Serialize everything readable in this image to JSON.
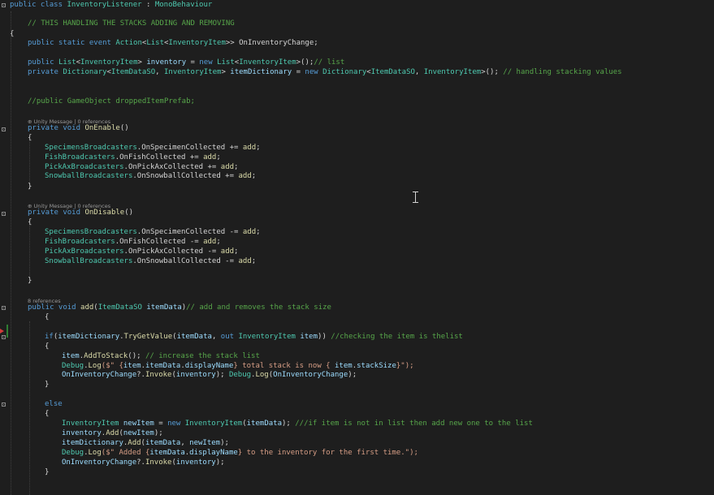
{
  "editor": {
    "lines": [
      [
        [
          "public class ",
          "kw"
        ],
        [
          "InventoryListener",
          "ty"
        ],
        [
          " : ",
          "pl"
        ],
        [
          "MonoBehaviour",
          "ty"
        ]
      ],
      [
        [
          "// THIS HANDLING THE STACKS ADDING AND REMOVING",
          "cm"
        ]
      ],
      [
        [
          "{",
          "pl"
        ]
      ],
      [
        [
          "public static event ",
          "kw"
        ],
        [
          "Action",
          "ty"
        ],
        [
          "<",
          "pl"
        ],
        [
          "List",
          "ty"
        ],
        [
          "<",
          "pl"
        ],
        [
          "InventoryItem",
          "ty"
        ],
        [
          ">> ",
          "pl"
        ],
        [
          "OnInventoryChange",
          "pl"
        ],
        [
          ";",
          "pl"
        ]
      ],
      [
        [
          "public ",
          "kw"
        ],
        [
          "List",
          "ty"
        ],
        [
          "<",
          "pl"
        ],
        [
          "InventoryItem",
          "ty"
        ],
        [
          "> ",
          "pl"
        ],
        [
          "inventory",
          "pr"
        ],
        [
          " = ",
          "pl"
        ],
        [
          "new ",
          "kw"
        ],
        [
          "List",
          "ty"
        ],
        [
          "<",
          "pl"
        ],
        [
          "InventoryItem",
          "ty"
        ],
        [
          ">();",
          "pl"
        ],
        [
          "// list",
          "cm"
        ]
      ],
      [
        [
          "private ",
          "kw"
        ],
        [
          "Dictionary",
          "ty"
        ],
        [
          "<",
          "pl"
        ],
        [
          "ItemDataSO",
          "ty"
        ],
        [
          ", ",
          "pl"
        ],
        [
          "InventoryItem",
          "ty"
        ],
        [
          "> ",
          "pl"
        ],
        [
          "itemDictionary",
          "pr"
        ],
        [
          " = ",
          "pl"
        ],
        [
          "new ",
          "kw"
        ],
        [
          "Dictionary",
          "ty"
        ],
        [
          "<",
          "pl"
        ],
        [
          "ItemDataSO",
          "ty"
        ],
        [
          ", ",
          "pl"
        ],
        [
          "InventoryItem",
          "ty"
        ],
        [
          ">(); ",
          "pl"
        ],
        [
          "// handling stacking values",
          "cm"
        ]
      ],
      [
        [
          "//public GameObject droppedItemPrefab;",
          "cm"
        ]
      ],
      [
        [
          "private void ",
          "kw"
        ],
        [
          "OnEnable",
          "fn"
        ],
        [
          "()",
          "pl"
        ]
      ],
      [
        [
          "{",
          "pl"
        ]
      ],
      [
        [
          "SpecimensBroadcasters",
          "ty"
        ],
        [
          ".",
          "pl"
        ],
        [
          "OnSpecimenCollected",
          "pl"
        ],
        [
          " += ",
          "pl"
        ],
        [
          "add",
          "fn"
        ],
        [
          ";",
          "pl"
        ]
      ],
      [
        [
          "FishBroadcasters",
          "ty"
        ],
        [
          ".",
          "pl"
        ],
        [
          "OnFishCollected",
          "pl"
        ],
        [
          " += ",
          "pl"
        ],
        [
          "add",
          "fn"
        ],
        [
          ";",
          "pl"
        ]
      ],
      [
        [
          "PickAxBroadcasters",
          "ty"
        ],
        [
          ".",
          "pl"
        ],
        [
          "OnPickAxCollected",
          "pl"
        ],
        [
          " += ",
          "pl"
        ],
        [
          "add",
          "fn"
        ],
        [
          ";",
          "pl"
        ]
      ],
      [
        [
          "SnowballBroadcasters",
          "ty"
        ],
        [
          ".",
          "pl"
        ],
        [
          "OnSnowballCollected",
          "pl"
        ],
        [
          " += ",
          "pl"
        ],
        [
          "add",
          "fn"
        ],
        [
          ";",
          "pl"
        ]
      ],
      [
        [
          "}",
          "pl"
        ]
      ],
      [
        [
          "private void ",
          "kw"
        ],
        [
          "OnDisable",
          "fn"
        ],
        [
          "()",
          "pl"
        ]
      ],
      [
        [
          "{",
          "pl"
        ]
      ],
      [
        [
          "SpecimensBroadcasters",
          "ty"
        ],
        [
          ".",
          "pl"
        ],
        [
          "OnSpecimenCollected",
          "pl"
        ],
        [
          " -= ",
          "pl"
        ],
        [
          "add",
          "fn"
        ],
        [
          ";",
          "pl"
        ]
      ],
      [
        [
          "FishBroadcasters",
          "ty"
        ],
        [
          ".",
          "pl"
        ],
        [
          "OnFishCollected",
          "pl"
        ],
        [
          " -= ",
          "pl"
        ],
        [
          "add",
          "fn"
        ],
        [
          ";",
          "pl"
        ]
      ],
      [
        [
          "PickAxBroadcasters",
          "ty"
        ],
        [
          ".",
          "pl"
        ],
        [
          "OnPickAxCollected",
          "pl"
        ],
        [
          " -= ",
          "pl"
        ],
        [
          "add",
          "fn"
        ],
        [
          ";",
          "pl"
        ]
      ],
      [
        [
          "SnowballBroadcasters",
          "ty"
        ],
        [
          ".",
          "pl"
        ],
        [
          "OnSnowballCollected",
          "pl"
        ],
        [
          " -= ",
          "pl"
        ],
        [
          "add",
          "fn"
        ],
        [
          ";",
          "pl"
        ]
      ],
      [
        [
          "}",
          "pl"
        ]
      ],
      [
        [
          "public void ",
          "kw"
        ],
        [
          "add",
          "fn"
        ],
        [
          "(",
          "pl"
        ],
        [
          "ItemDataSO",
          "ty"
        ],
        [
          " ",
          "pl"
        ],
        [
          "itemData",
          "pr"
        ],
        [
          ")",
          "pl"
        ],
        [
          "// add and removes the stack size",
          "cm"
        ]
      ],
      [
        [
          "{",
          "pl"
        ]
      ],
      [
        [
          "if",
          "kw"
        ],
        [
          "(",
          "pl"
        ],
        [
          "itemDictionary",
          "pr"
        ],
        [
          ".",
          "pl"
        ],
        [
          "TryGetValue",
          "fn"
        ],
        [
          "(",
          "pl"
        ],
        [
          "itemData",
          "pr"
        ],
        [
          ", ",
          "pl"
        ],
        [
          "out ",
          "kw"
        ],
        [
          "InventoryItem",
          "ty"
        ],
        [
          " ",
          "pl"
        ],
        [
          "item",
          "pr"
        ],
        [
          ")) ",
          "pl"
        ],
        [
          "//checking the item is thelist",
          "cm"
        ]
      ],
      [
        [
          "{",
          "pl"
        ]
      ],
      [
        [
          "item",
          "pr"
        ],
        [
          ".",
          "pl"
        ],
        [
          "AddToStack",
          "fn"
        ],
        [
          "(); ",
          "pl"
        ],
        [
          "// increase the stack list",
          "cm"
        ]
      ],
      [
        [
          "Debug",
          "ty"
        ],
        [
          ".",
          "pl"
        ],
        [
          "Log",
          "fn"
        ],
        [
          "($\" {",
          "st"
        ],
        [
          "item",
          "pr"
        ],
        [
          ".",
          "pl"
        ],
        [
          "itemData",
          "pr"
        ],
        [
          ".",
          "pl"
        ],
        [
          "displayName",
          "pr"
        ],
        [
          "} total stack is now { ",
          "st"
        ],
        [
          "item",
          "pr"
        ],
        [
          ".",
          "pl"
        ],
        [
          "stackSize",
          "pr"
        ],
        [
          "}\");",
          "st"
        ]
      ],
      [
        [
          "OnInventoryChange",
          "pr"
        ],
        [
          "?.",
          "pl"
        ],
        [
          "Invoke",
          "fn"
        ],
        [
          "(",
          "pl"
        ],
        [
          "inventory",
          "pr"
        ],
        [
          "); ",
          "pl"
        ],
        [
          "Debug",
          "ty"
        ],
        [
          ".",
          "pl"
        ],
        [
          "Log",
          "fn"
        ],
        [
          "(",
          "pl"
        ],
        [
          "OnInventoryChange",
          "pr"
        ],
        [
          ");",
          "pl"
        ]
      ],
      [
        [
          "}",
          "pl"
        ]
      ],
      [
        [
          "else",
          "kw"
        ]
      ],
      [
        [
          "{",
          "pl"
        ]
      ],
      [
        [
          "InventoryItem",
          "ty"
        ],
        [
          " ",
          "pl"
        ],
        [
          "newItem",
          "pr"
        ],
        [
          " = ",
          "pl"
        ],
        [
          "new ",
          "kw"
        ],
        [
          "InventoryItem",
          "ty"
        ],
        [
          "(",
          "pl"
        ],
        [
          "itemData",
          "pr"
        ],
        [
          "); ",
          "pl"
        ],
        [
          "///if item is not in list then add new one to the list",
          "cm"
        ]
      ],
      [
        [
          "inventory",
          "pr"
        ],
        [
          ".",
          "pl"
        ],
        [
          "Add",
          "fn"
        ],
        [
          "(",
          "pl"
        ],
        [
          "newItem",
          "pr"
        ],
        [
          ");",
          "pl"
        ]
      ],
      [
        [
          "itemDictionary",
          "pr"
        ],
        [
          ".",
          "pl"
        ],
        [
          "Add",
          "fn"
        ],
        [
          "(",
          "pl"
        ],
        [
          "itemData",
          "pr"
        ],
        [
          ", ",
          "pl"
        ],
        [
          "newItem",
          "pr"
        ],
        [
          ");",
          "pl"
        ]
      ],
      [
        [
          "Debug",
          "ty"
        ],
        [
          ".",
          "pl"
        ],
        [
          "Log",
          "fn"
        ],
        [
          "($\" Added {",
          "st"
        ],
        [
          "itemData",
          "pr"
        ],
        [
          ".",
          "pl"
        ],
        [
          "displayName",
          "pr"
        ],
        [
          "} to the inventory for the first time.\");",
          "st"
        ]
      ],
      [
        [
          "OnInventoryChange",
          "pr"
        ],
        [
          "?.",
          "pl"
        ],
        [
          "Invoke",
          "fn"
        ],
        [
          "(",
          "pl"
        ],
        [
          "inventory",
          "pr"
        ],
        [
          ");",
          "pl"
        ]
      ],
      [
        [
          "}",
          "pl"
        ]
      ]
    ],
    "codelens": [
      "⊕ Unity Message | 0 references",
      "⊕ Unity Message | 0 references",
      "8 references"
    ]
  }
}
